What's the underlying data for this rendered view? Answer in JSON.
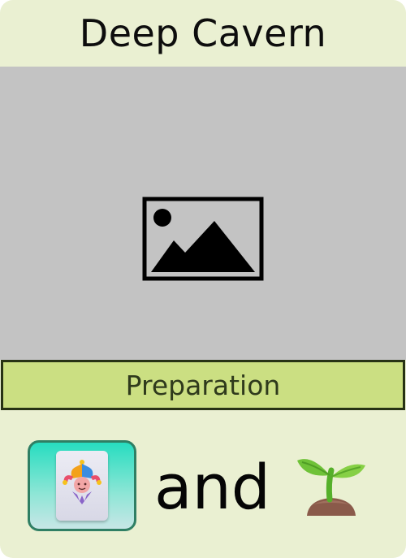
{
  "card": {
    "title": "Deep Cavern",
    "art": {
      "icon": "image-placeholder-icon"
    },
    "type_label": "Preparation",
    "requirement": {
      "left_icon": "jester-card-icon",
      "connector": "and",
      "right_icon": "seedling-icon"
    }
  },
  "colors": {
    "card_background": "#eaf0d2",
    "art_background": "#c3c3c3",
    "type_band": "#cbdf82",
    "type_band_border": "#273214",
    "tile_teal": "#27ddc0",
    "tile_border": "#2f7f64"
  }
}
